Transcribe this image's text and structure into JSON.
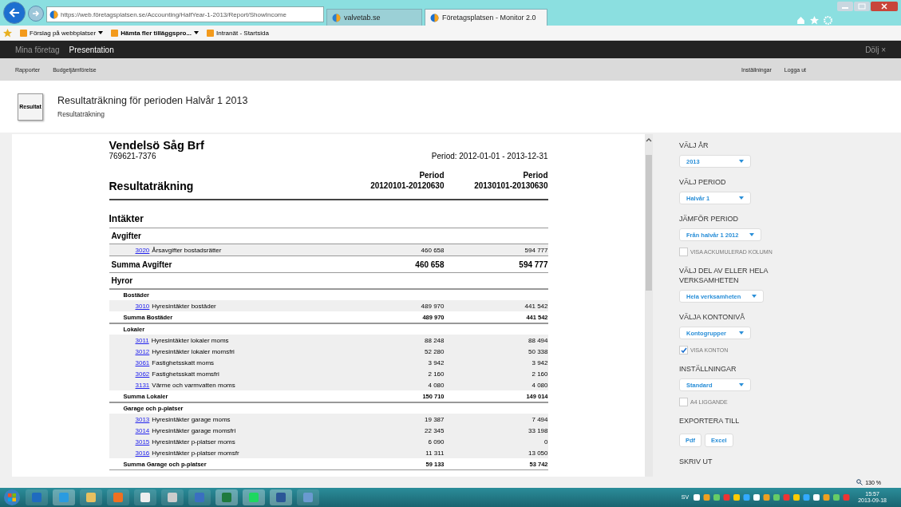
{
  "browser": {
    "url": "https://web.företagsplatsen.se/Accounting/HalfYear-1-2013/Report/ShowIncome",
    "tabs": [
      {
        "label": "valvetab.se",
        "selected": false
      },
      {
        "label": "Företagsplatsen - Monitor 2.0",
        "selected": true
      }
    ],
    "favorites": [
      {
        "label": "Förslag på webbplatser",
        "dropdown": true
      },
      {
        "label": "Hämta fler tilläggspro...",
        "dropdown": true
      },
      {
        "label": "Intranät - Startsida",
        "dropdown": false
      }
    ]
  },
  "nav": {
    "items": [
      {
        "label": "Mina företag",
        "selected": false
      },
      {
        "label": "Presentation",
        "selected": true
      }
    ],
    "hide": "Dölj ×"
  },
  "subnav": {
    "left": [
      "Rapporter",
      "Budgetjämförelse"
    ],
    "right": [
      "Inställningar",
      "Logga ut"
    ]
  },
  "header": {
    "icon_label": "Resultat",
    "title": "Resultaträkning för perioden Halvår 1 2013",
    "subtitle": "Resultaträkning"
  },
  "report": {
    "company": "Vendelsö Såg Brf",
    "org_number": "769621-7376",
    "period": "Period: 2012-01-01 - 2013-12-31",
    "title": "Resultaträkning",
    "columns": [
      [
        "Period",
        "20120101-20120630"
      ],
      [
        "Period",
        "20130101-20130630"
      ]
    ],
    "rows": [
      {
        "kind": "section",
        "label": "Intäkter"
      },
      {
        "kind": "group",
        "label": "Avgifter"
      },
      {
        "kind": "account",
        "code": "3020",
        "label": "Årsavgifter bostadsrätter",
        "values": [
          "460 658",
          "594 777"
        ]
      },
      {
        "kind": "sum",
        "label": "Summa Avgifter",
        "values": [
          "460 658",
          "594 777"
        ]
      },
      {
        "kind": "group",
        "label": "Hyror"
      },
      {
        "kind": "subgroup",
        "label": "Bostäder"
      },
      {
        "kind": "account",
        "code": "3010",
        "label": "Hyresintäkter bostäder",
        "values": [
          "489 970",
          "441 542"
        ]
      },
      {
        "kind": "subsum",
        "label": "Summa Bostäder",
        "values": [
          "489 970",
          "441 542"
        ]
      },
      {
        "kind": "subgroup",
        "label": "Lokaler"
      },
      {
        "kind": "account",
        "code": "3011",
        "label": "Hyresintäkter lokaler moms",
        "values": [
          "88 248",
          "88 494"
        ]
      },
      {
        "kind": "account",
        "code": "3012",
        "label": "Hyresintäkter lokaler momsfri",
        "values": [
          "52 280",
          "50 338"
        ]
      },
      {
        "kind": "account",
        "code": "3061",
        "label": "Fastighetsskatt moms",
        "values": [
          "3 942",
          "3 942"
        ]
      },
      {
        "kind": "account",
        "code": "3062",
        "label": "Fastighetsskatt momsfri",
        "values": [
          "2 160",
          "2 160"
        ]
      },
      {
        "kind": "account",
        "code": "3131",
        "label": "Värme och varmvatten moms",
        "values": [
          "4 080",
          "4 080"
        ]
      },
      {
        "kind": "subsum",
        "label": "Summa Lokaler",
        "values": [
          "150 710",
          "149 014"
        ]
      },
      {
        "kind": "subgroup",
        "label": "Garage och p-platser"
      },
      {
        "kind": "account",
        "code": "3013",
        "label": "Hyresintäkter garage moms",
        "values": [
          "19 387",
          "7 494"
        ]
      },
      {
        "kind": "account",
        "code": "3014",
        "label": "Hyresintäkter garage momsfri",
        "values": [
          "22 345",
          "33 198"
        ]
      },
      {
        "kind": "account",
        "code": "3015",
        "label": "Hyresintäkter p-platser moms",
        "values": [
          "6 090",
          "0"
        ]
      },
      {
        "kind": "account",
        "code": "3016",
        "label": "Hyresintäkter p-platser momsfr",
        "values": [
          "11 311",
          "13 050"
        ]
      },
      {
        "kind": "subsum",
        "label": "Summa Garage och p-platser",
        "values": [
          "59 133",
          "53 742"
        ]
      }
    ]
  },
  "sidebar": [
    {
      "kind": "heading",
      "label": "VÄLJ ÅR"
    },
    {
      "kind": "select",
      "value": "2013"
    },
    {
      "kind": "heading",
      "label": "VÄLJ PERIOD"
    },
    {
      "kind": "select",
      "value": "Halvår 1"
    },
    {
      "kind": "heading",
      "label": "JÄMFÖR PERIOD"
    },
    {
      "kind": "select",
      "value": "Från halvår 1 2012"
    },
    {
      "kind": "checkbox",
      "label": "VISA ACKUMULERAD KOLUMN",
      "checked": false
    },
    {
      "kind": "heading",
      "label": "VÄLJ DEL AV ELLER HELA VERKSAMHETEN"
    },
    {
      "kind": "select",
      "value": "Hela verksamheten"
    },
    {
      "kind": "heading",
      "label": "VÄLJA KONTONIVÅ"
    },
    {
      "kind": "select",
      "value": "Kontogrupper"
    },
    {
      "kind": "checkbox",
      "label": "VISA KONTON",
      "checked": true
    },
    {
      "kind": "heading",
      "label": "INSTÄLLNINGAR"
    },
    {
      "kind": "select",
      "value": "Standard"
    },
    {
      "kind": "checkbox",
      "label": "A4 LIGGANDE",
      "checked": false
    },
    {
      "kind": "heading",
      "label": "EXPORTERA TILL"
    },
    {
      "kind": "buttons",
      "labels": [
        "Pdf",
        "Excel"
      ]
    },
    {
      "kind": "heading",
      "label": "SKRIV UT"
    }
  ],
  "status": {
    "zoom": "130 %"
  },
  "taskbar": {
    "language": "SV",
    "time": "15:57",
    "date": "2013-09-18"
  }
}
